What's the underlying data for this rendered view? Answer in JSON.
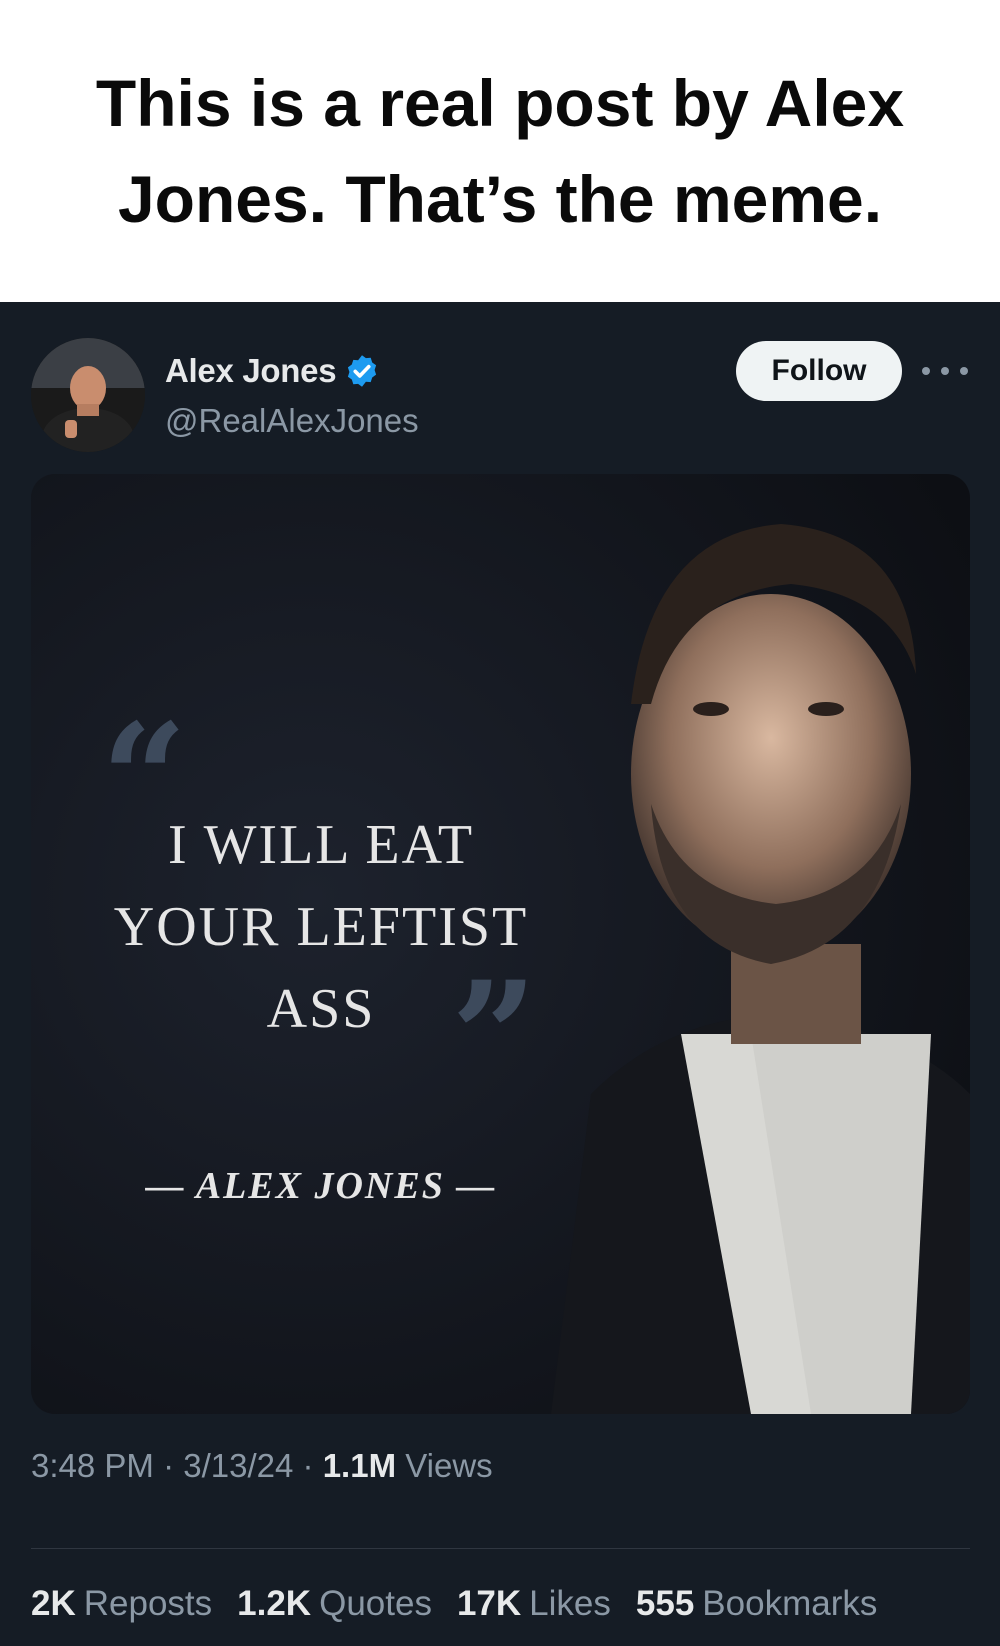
{
  "caption": {
    "text": "This is a real post by Alex Jones. That’s the meme."
  },
  "post": {
    "author": {
      "display_name": "Alex Jones",
      "handle": "@RealAlexJones",
      "verified": true
    },
    "follow_label": "Follow",
    "media": {
      "quote_open": "“",
      "quote_lines": [
        "I WILL EAT",
        "YOUR LEFTIST",
        "ASS"
      ],
      "quote_close": "”",
      "attribution": "— ALEX JONES —"
    },
    "meta": {
      "time": "3:48 PM",
      "separator": "·",
      "date": "3/13/24",
      "views_count": "1.1M",
      "views_label": "Views"
    },
    "stats": [
      {
        "count": "2K",
        "label": "Reposts"
      },
      {
        "count": "1.2K",
        "label": "Quotes"
      },
      {
        "count": "17K",
        "label": "Likes"
      },
      {
        "count": "555",
        "label": "Bookmarks"
      }
    ]
  },
  "colors": {
    "background": "#151c25",
    "text_primary": "#e7e9ea",
    "text_secondary": "#8b98a5",
    "verified_blue": "#1d9bf0",
    "follow_bg": "#eff3f4"
  },
  "icons": [
    "verified-badge-icon",
    "more-options-icon"
  ]
}
